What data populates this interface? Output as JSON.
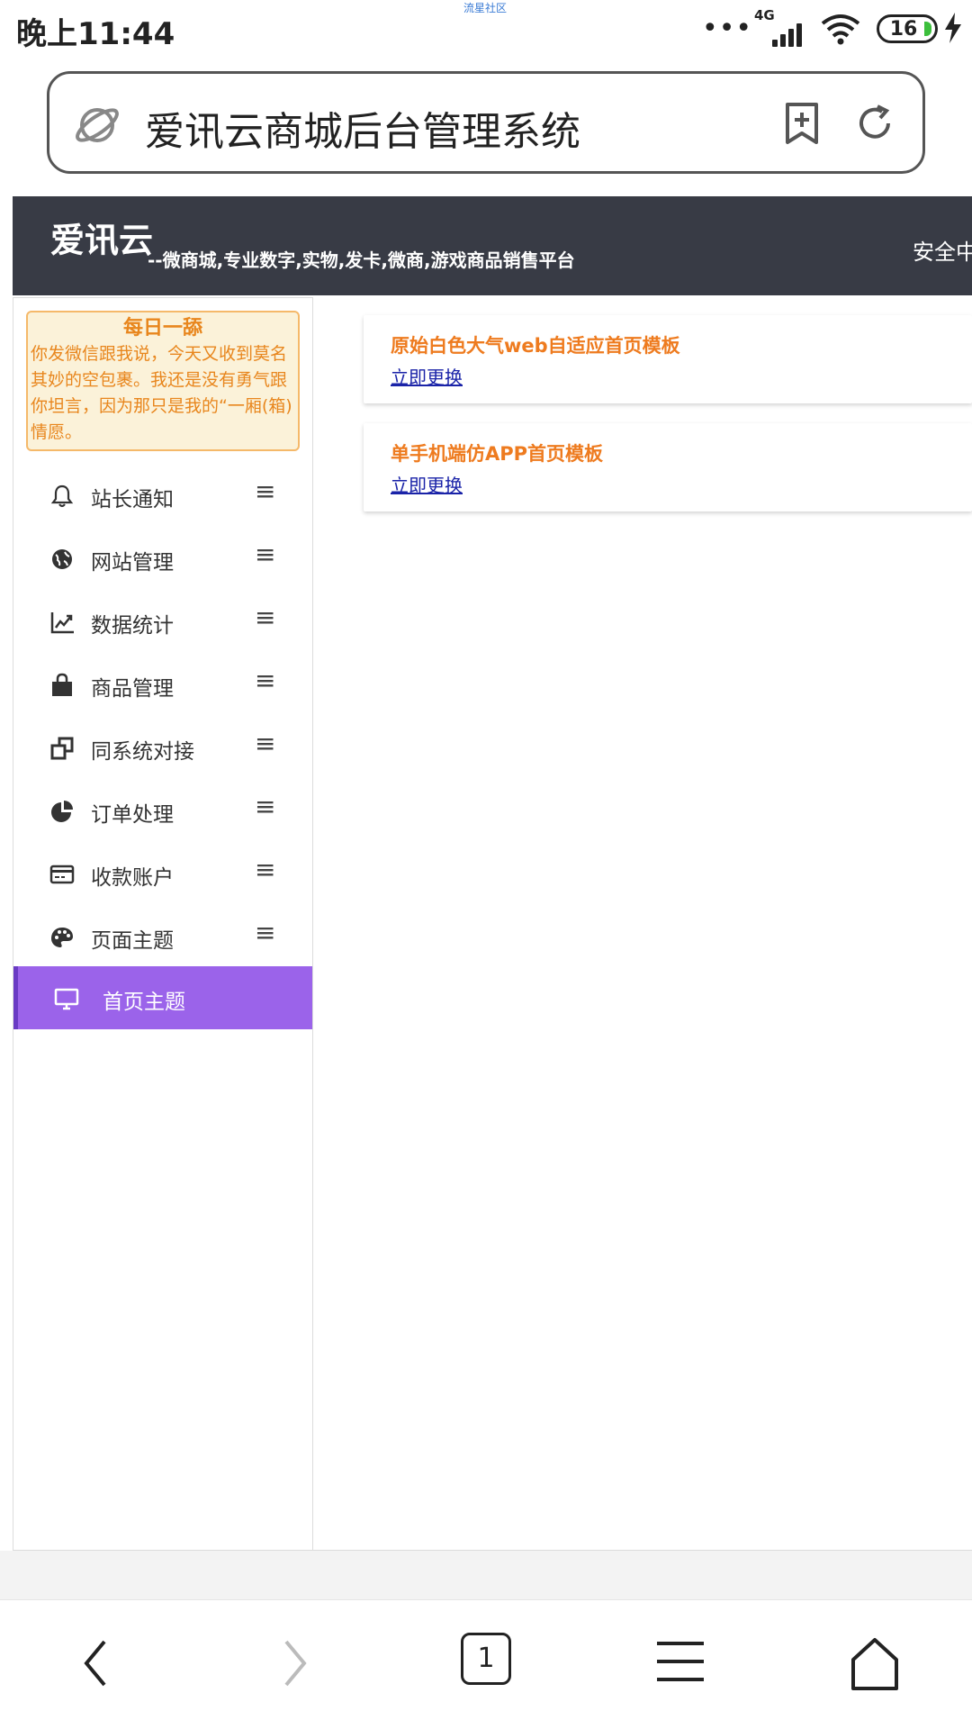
{
  "status_bar": {
    "time": "晚上11:44",
    "watermark": "流星社区",
    "dots": "•••",
    "network": "4G",
    "battery": "16"
  },
  "address_bar": {
    "title": "爱讯云商城后台管理系统"
  },
  "header": {
    "brand": "爱讯云",
    "tagline": "--微商城,专业数字,实物,发卡,微商,游戏商品销售平台",
    "security": "安全中心"
  },
  "notice": {
    "title": "每日一舔",
    "body": "你发微信跟我说，今天又收到莫名其妙的空包裹。我还是没有勇气跟你坦言，因为那只是我的“一厢(箱)情愿。"
  },
  "sidebar": {
    "more_glyph": "≡",
    "items": [
      {
        "label": "站长通知",
        "icon": "bell-icon"
      },
      {
        "label": "网站管理",
        "icon": "globe-icon"
      },
      {
        "label": "数据统计",
        "icon": "chart-line-icon"
      },
      {
        "label": "商品管理",
        "icon": "shopping-bag-icon"
      },
      {
        "label": "同系统对接",
        "icon": "clone-icon"
      },
      {
        "label": "订单处理",
        "icon": "pie-chart-icon"
      },
      {
        "label": "收款账户",
        "icon": "credit-card-icon"
      },
      {
        "label": "页面主题",
        "icon": "palette-icon"
      },
      {
        "label": "首页主题",
        "icon": "desktop-icon",
        "active": true
      }
    ]
  },
  "templates": [
    {
      "title": "原始白色大气web自适应首页模板",
      "action": "立即更换"
    },
    {
      "title": "单手机端仿APP首页模板",
      "action": "立即更换"
    }
  ],
  "bottom_nav": {
    "tabs_count": "1"
  },
  "colors": {
    "header_bg": "#383b45",
    "active_menu": "#9b63ea",
    "accent_orange": "#ee7b1f",
    "link_blue": "#1a23a8"
  }
}
